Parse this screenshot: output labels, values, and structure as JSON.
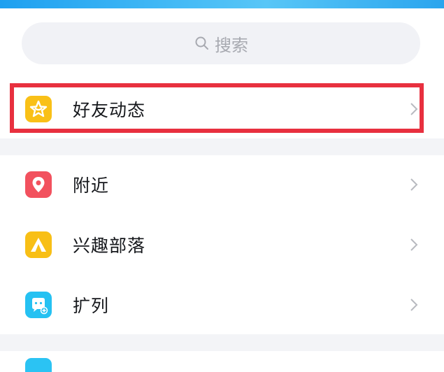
{
  "search": {
    "placeholder": "搜索"
  },
  "menu": {
    "items": [
      {
        "label": "好友动态",
        "icon": "star-badge-icon",
        "color": "#f9c017"
      },
      {
        "label": "附近",
        "icon": "location-pin-icon",
        "color": "#f2515e"
      },
      {
        "label": "兴趣部落",
        "icon": "tent-icon",
        "color": "#f8bf16"
      },
      {
        "label": "扩列",
        "icon": "chat-face-icon",
        "color": "#25c1f2"
      }
    ]
  },
  "colors": {
    "highlight": "#e8303f",
    "banner": "#2aa5ee",
    "separator": "#f3f4f7"
  }
}
